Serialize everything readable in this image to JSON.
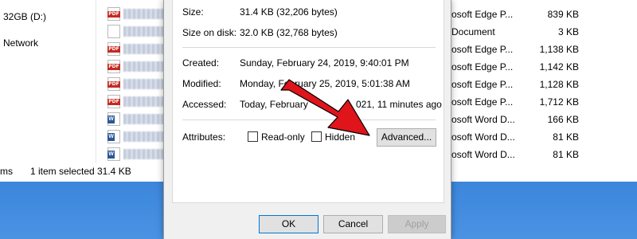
{
  "explorer": {
    "nav": [
      {
        "label": "32GB (D:)"
      },
      {
        "label": "Network"
      }
    ],
    "right_rows": [
      {
        "type": "osoft Edge P...",
        "size": "839 KB"
      },
      {
        "type": "Document",
        "size": "3 KB"
      },
      {
        "type": "osoft Edge P...",
        "size": "1,138 KB"
      },
      {
        "type": "osoft Edge P...",
        "size": "1,142 KB"
      },
      {
        "type": "osoft Edge P...",
        "size": "1,128 KB"
      },
      {
        "type": "osoft Edge P...",
        "size": "1,712 KB"
      },
      {
        "type": "osoft Word D...",
        "size": "166 KB"
      },
      {
        "type": "osoft Word D...",
        "size": "81 KB"
      },
      {
        "type": "osoft Word D...",
        "size": "81 KB"
      }
    ],
    "status": {
      "items_fragment": "ms",
      "selected": "1 item selected",
      "size": "31.4 KB"
    }
  },
  "dialog": {
    "size_label": "Size:",
    "size_value": "31.4 KB (32,206 bytes)",
    "size_on_disk_label": "Size on disk:",
    "size_on_disk_value": "32.0 KB (32,768 bytes)",
    "created_label": "Created:",
    "created_value": "Sunday, February 24, 2019, 9:40:01 PM",
    "modified_label": "Modified:",
    "modified_value": "Monday, February 25, 2019, 5:01:38 AM",
    "accessed_label": "Accessed:",
    "accessed_value": "Today, February ",
    "accessed_value_tail": "021, 11 minutes ago",
    "attributes_label": "Attributes:",
    "readonly_label": "Read-only",
    "hidden_label": "Hidden",
    "advanced_label": "Advanced...",
    "ok_label": "OK",
    "cancel_label": "Cancel",
    "apply_label": "Apply"
  },
  "colors": {
    "arrow": "#e0141b",
    "focus": "#0078d7"
  }
}
